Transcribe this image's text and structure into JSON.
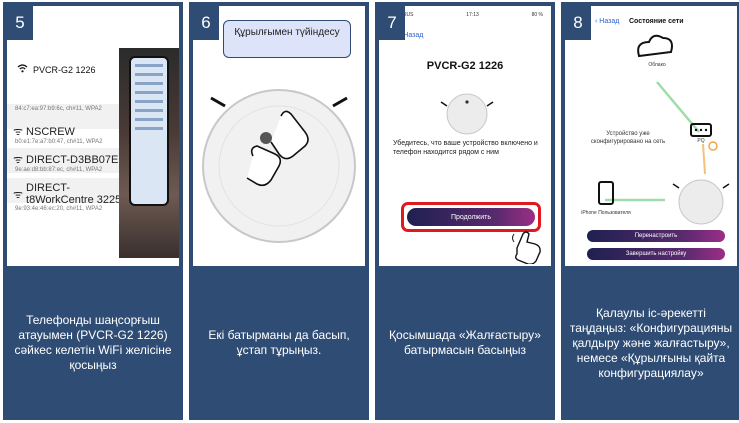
{
  "panels": [
    {
      "number": "5",
      "caption": "Телефонды шаңсорғыш атауымен (PVCR-G2 1226) сәйкес келетін WiFi желісіне қосыңыз",
      "screen": {
        "selected_ssid": "PVCR-G2 1226",
        "networks": [
          {
            "name": "",
            "meta": "84:c7:ea:97:b9:6c, ch#11, WPA2"
          },
          {
            "name": "NSCREW",
            "meta": "b0:e1:7e:a7:b0:47, ch#11, WPA2"
          },
          {
            "name": "DIRECT-D3BB07EC",
            "meta": "9e:ae:d8:bb:87:ec, ch#11, WPA2"
          },
          {
            "name": "DIRECT-t8WorkCentre 3225",
            "meta": "9e:93:4e:46:ec:20, ch#11, WPA2"
          }
        ]
      }
    },
    {
      "number": "6",
      "bubble": "Құрылғымен түйіндесу",
      "caption": "Екі батырманы да басып, ұстап тұрыңыз."
    },
    {
      "number": "7",
      "caption": "Қосымшада «Жалғастыру» батырмасын басыңыз",
      "screen": {
        "carrier": "MTS RUS",
        "time": "17:13",
        "battery": "80 %",
        "back": "Назад",
        "model": "PVCR-G2 1226",
        "message": "Убедитесь, что ваше устройство включено и телефон находится рядом с ним",
        "continue": "Продолжить"
      }
    },
    {
      "number": "8",
      "caption": "Қалаулы іс-әрекетті таңдаңыз: «Конфигурацияны қалдыру және жалғастыру», немесе «Құрылғыны қайта конфигурациялау»",
      "screen": {
        "back": "Назад",
        "title": "Состояние сети",
        "cloud": "Облако",
        "configured": "Устройство уже сконфигурировано на сеть",
        "router_label": "PQ",
        "phone_label": "iPhone Пользователя",
        "reconfigure": "Перенастроить",
        "finish": "Завершить настройку"
      }
    }
  ],
  "colors": {
    "panel_bg": "#2f4d74",
    "bubble_bg": "#dde3f8",
    "highlight_red": "#e0191e",
    "status_green": "#9fdca8",
    "button_gradient_start": "#1e2050",
    "button_gradient_end": "#9b2e86"
  }
}
